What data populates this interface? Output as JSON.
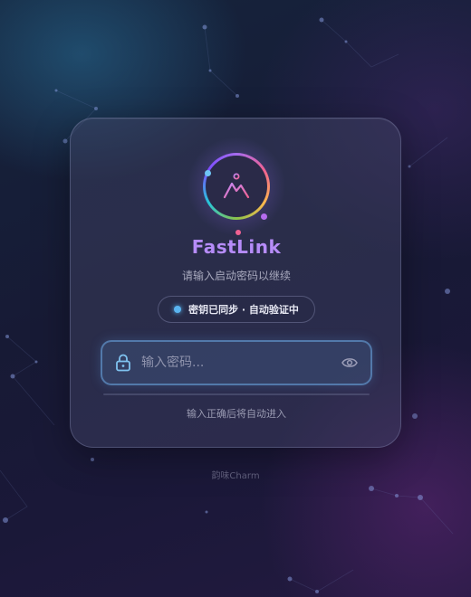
{
  "app": {
    "title": "FastLink",
    "subtitle": "请输入启动密码以继续"
  },
  "status": {
    "text": "密钥已同步 · 自动验证中",
    "dot_color": "#5ab4f0"
  },
  "password": {
    "placeholder": "输入密码...",
    "value": "",
    "lock_icon": "lock-icon",
    "toggle_icon": "eye-icon"
  },
  "progress": {
    "value": 0
  },
  "hint": "输入正确后将自动进入",
  "footer": "韵味Charm",
  "colors": {
    "title_accent": "#b68cf8",
    "input_border": "#6eaae6",
    "card_background": "#46486a"
  }
}
